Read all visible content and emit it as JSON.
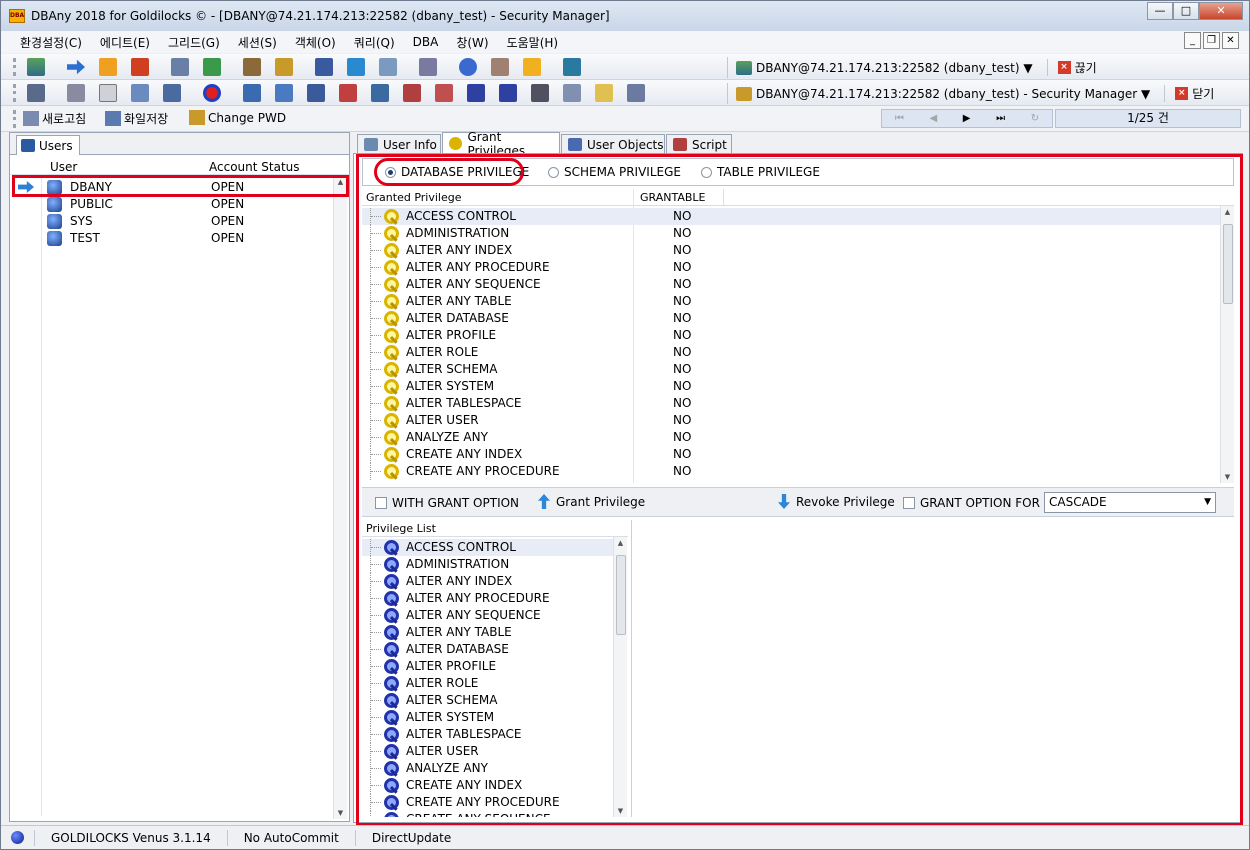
{
  "window": {
    "title": "DBAny 2018 for Goldilocks © - [DBANY@74.21.174.213:22582 (dbany_test) - Security Manager]",
    "app_icon": "DBA"
  },
  "menu": [
    "환경설정(C)",
    "에디트(E)",
    "그리드(G)",
    "세션(S)",
    "객체(O)",
    "쿼리(Q)",
    "DBA",
    "창(W)",
    "도움말(H)"
  ],
  "connection1": {
    "label": "DBANY@74.21.174.213:22582 (dbany_test) ▼",
    "action": "끊기"
  },
  "connection2": {
    "label": "DBANY@74.21.174.213:22582 (dbany_test) - Security Manager ▼",
    "action": "닫기"
  },
  "actions": {
    "refresh": "새로고침",
    "save_file": "화일저장",
    "change_pwd": "Change PWD"
  },
  "pager": {
    "text": "1/25 건"
  },
  "left": {
    "tab": "Users",
    "col_user": "User",
    "col_status": "Account Status",
    "users": [
      {
        "name": "DBANY",
        "status": "OPEN"
      },
      {
        "name": "PUBLIC",
        "status": "OPEN"
      },
      {
        "name": "SYS",
        "status": "OPEN"
      },
      {
        "name": "TEST",
        "status": "OPEN"
      }
    ]
  },
  "tabs": [
    "User Info",
    "Grant Privileges",
    "User Objects",
    "Script"
  ],
  "scope": {
    "database": "DATABASE PRIVILEGE",
    "schema": "SCHEMA PRIVILEGE",
    "table": "TABLE PRIVILEGE",
    "selected": "DATABASE PRIVILEGE"
  },
  "granted": {
    "col_privilege": "Granted Privilege",
    "col_grantable": "GRANTABLE",
    "rows": [
      {
        "name": "ACCESS CONTROL",
        "grantable": "NO"
      },
      {
        "name": "ADMINISTRATION",
        "grantable": "NO"
      },
      {
        "name": "ALTER ANY INDEX",
        "grantable": "NO"
      },
      {
        "name": "ALTER ANY PROCEDURE",
        "grantable": "NO"
      },
      {
        "name": "ALTER ANY SEQUENCE",
        "grantable": "NO"
      },
      {
        "name": "ALTER ANY TABLE",
        "grantable": "NO"
      },
      {
        "name": "ALTER DATABASE",
        "grantable": "NO"
      },
      {
        "name": "ALTER PROFILE",
        "grantable": "NO"
      },
      {
        "name": "ALTER ROLE",
        "grantable": "NO"
      },
      {
        "name": "ALTER SCHEMA",
        "grantable": "NO"
      },
      {
        "name": "ALTER SYSTEM",
        "grantable": "NO"
      },
      {
        "name": "ALTER TABLESPACE",
        "grantable": "NO"
      },
      {
        "name": "ALTER USER",
        "grantable": "NO"
      },
      {
        "name": "ANALYZE ANY",
        "grantable": "NO"
      },
      {
        "name": "CREATE ANY INDEX",
        "grantable": "NO"
      },
      {
        "name": "CREATE ANY PROCEDURE",
        "grantable": "NO"
      }
    ]
  },
  "controls": {
    "with_grant_option": "WITH GRANT OPTION",
    "grant_button": "Grant Privilege",
    "revoke_button": "Revoke Privilege",
    "grant_option_for": "GRANT OPTION FOR",
    "cascade_value": "CASCADE"
  },
  "privilege_list": {
    "header": "Privilege List",
    "rows": [
      "ACCESS CONTROL",
      "ADMINISTRATION",
      "ALTER ANY INDEX",
      "ALTER ANY PROCEDURE",
      "ALTER ANY SEQUENCE",
      "ALTER ANY TABLE",
      "ALTER DATABASE",
      "ALTER PROFILE",
      "ALTER ROLE",
      "ALTER SCHEMA",
      "ALTER SYSTEM",
      "ALTER TABLESPACE",
      "ALTER USER",
      "ANALYZE ANY",
      "CREATE ANY INDEX",
      "CREATE ANY PROCEDURE",
      "CREATE ANY SEQUENCE"
    ]
  },
  "status": {
    "product": "GOLDILOCKS Venus 3.1.14",
    "commit": "No AutoCommit",
    "update": "DirectUpdate"
  },
  "colors": {
    "highlight": "#e0001a",
    "accent": "#2b87d8"
  }
}
